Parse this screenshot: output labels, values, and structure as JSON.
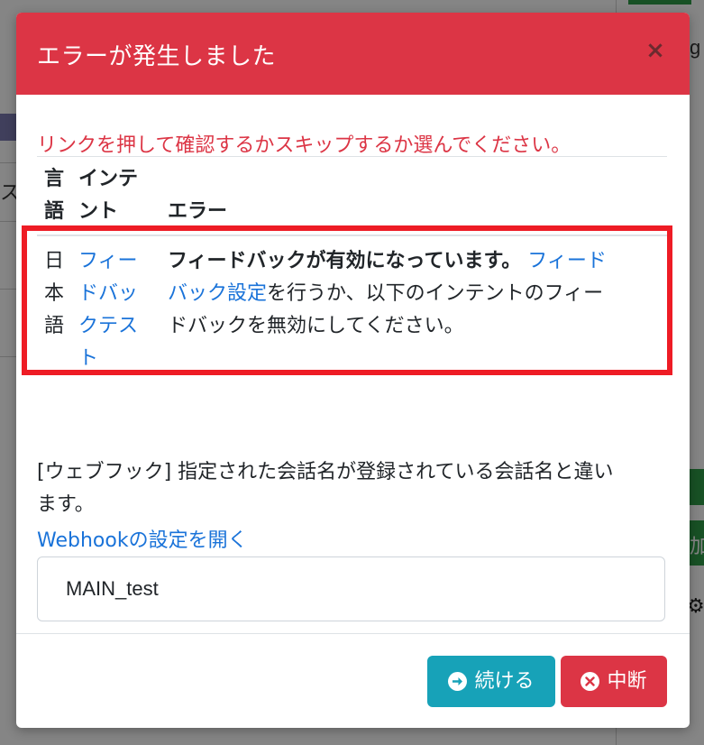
{
  "background": {
    "left_char": "ス",
    "right_top_char": "g",
    "right_mid_char": "加",
    "gear_icon": "gear-icon"
  },
  "modal": {
    "title": "エラーが発生しました",
    "close_symbol": "×",
    "instruction": "リンクを押して確認するかスキップするか選んでください。",
    "table": {
      "headers": {
        "language": "言語",
        "language_l1": "言",
        "language_l2": "語",
        "intent": "インテント",
        "intent_l1": "インテ",
        "intent_l2": "ント",
        "error": "エラー"
      },
      "row": {
        "language": "日本語",
        "language_l1": "日",
        "language_l2": "本",
        "language_l3": "語",
        "intent": "フィードバックテスト",
        "intent_l1": "フィー",
        "intent_l2": "ドバッ",
        "intent_l3": "クテス",
        "intent_l4": "ト",
        "error_bold": "フィードバックが有効になっています。",
        "error_link_a": "フィード",
        "error_link_b": "バック設定",
        "error_rest_a": "を行うか、以下のインテントのフィー",
        "error_rest_b": "ドバックを無効にしてください。"
      }
    },
    "webhook_message_l1": "[ウェブフック] 指定された会話名が登録されている会話名と違い",
    "webhook_message_l2": "ます。",
    "webhook_link": "Webhookの設定を開く",
    "conversation_name": "MAIN_test",
    "buttons": {
      "continue": "続ける",
      "abort": "中断"
    },
    "colors": {
      "header": "#dc3545",
      "continue": "#17a2b8",
      "abort": "#dc3545",
      "link": "#1a73d9",
      "highlight": "#ee1c25"
    }
  }
}
